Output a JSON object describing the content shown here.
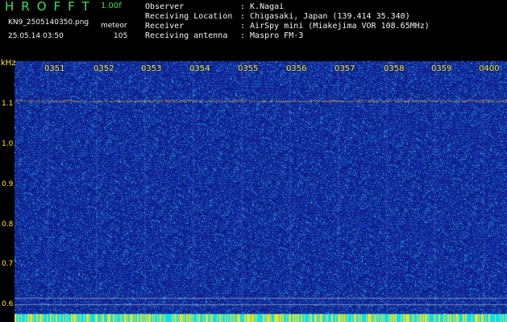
{
  "header": {
    "app_title": "HROFFT",
    "version": "1.00f",
    "filename": "KN9_2505140350.png",
    "datetime": "25.05.14 03:50",
    "mode": "meteor",
    "count": "105"
  },
  "info": [
    {
      "label": "Observer",
      "value": ": K.Nagai"
    },
    {
      "label": "Receiving Location",
      "value": ": Chigasaki, Japan (139.414 35.340)"
    },
    {
      "label": "Receiver",
      "value": ": AirSpy mini (Miakejima VOR 108.65MHz)"
    },
    {
      "label": "Receiving antenna",
      "value": ": Maspro FM-3"
    }
  ],
  "axes": {
    "y_unit": "kHz",
    "y_ticks": [
      "1.1",
      "1.0",
      "0.9",
      "0.8",
      "0.7",
      "0.6"
    ],
    "y_range_khz": [
      0.57,
      1.2
    ],
    "x_ticks": [
      "0351",
      "0352",
      "0353",
      "0354",
      "0355",
      "0356",
      "0357",
      "0358",
      "0359",
      "0400"
    ]
  },
  "colors": {
    "background": "#1b2ea8",
    "carrier_line": "#cc8833",
    "bottom_band": "#00e0ff",
    "label_yellow": "#ffe438",
    "label_green": "#3fe05a"
  }
}
